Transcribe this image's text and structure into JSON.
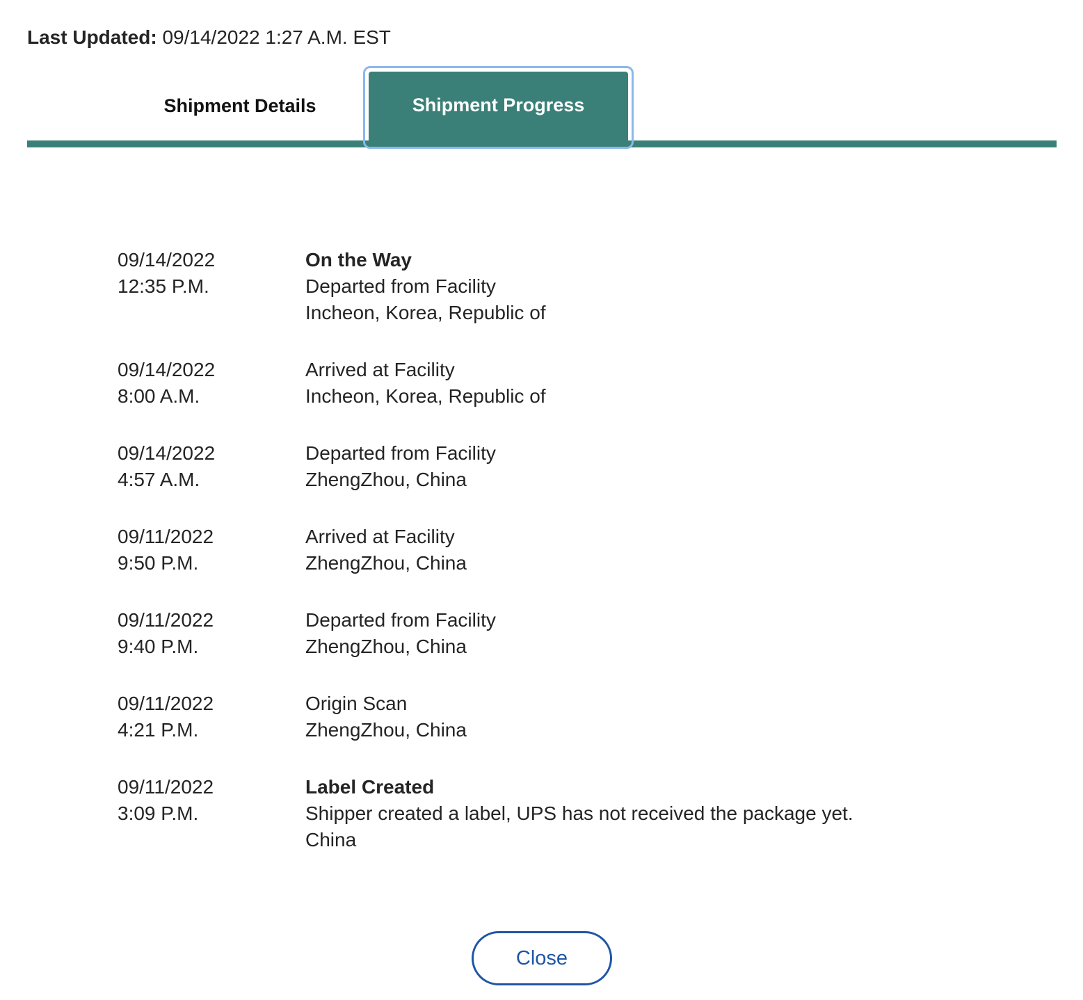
{
  "header": {
    "last_updated_label": "Last Updated:",
    "last_updated_value": "09/14/2022 1:27 A.M. EST"
  },
  "tabs": [
    {
      "label": "Shipment Details",
      "active": false
    },
    {
      "label": "Shipment Progress",
      "active": true
    }
  ],
  "progress": [
    {
      "date": "09/14/2022",
      "time": "12:35 P.M.",
      "status": "On the Way",
      "activity": "Departed from Facility",
      "location": "Incheon, Korea, Republic of"
    },
    {
      "date": "09/14/2022",
      "time": "8:00 A.M.",
      "status": "",
      "activity": "Arrived at Facility",
      "location": "Incheon, Korea, Republic of"
    },
    {
      "date": "09/14/2022",
      "time": "4:57 A.M.",
      "status": "",
      "activity": "Departed from Facility",
      "location": "ZhengZhou, China"
    },
    {
      "date": "09/11/2022",
      "time": "9:50 P.M.",
      "status": "",
      "activity": "Arrived at Facility",
      "location": "ZhengZhou, China"
    },
    {
      "date": "09/11/2022",
      "time": "9:40 P.M.",
      "status": "",
      "activity": "Departed from Facility",
      "location": "ZhengZhou, China"
    },
    {
      "date": "09/11/2022",
      "time": "4:21 P.M.",
      "status": "",
      "activity": "Origin Scan",
      "location": "ZhengZhou, China"
    },
    {
      "date": "09/11/2022",
      "time": "3:09 P.M.",
      "status": "Label Created",
      "activity": "Shipper created a label, UPS has not received the package yet.",
      "location": "China"
    }
  ],
  "footer": {
    "close_label": "Close"
  },
  "colors": {
    "accent": "#3a8078",
    "focus_ring": "#8bb8ec",
    "button_blue": "#1f55a5"
  }
}
